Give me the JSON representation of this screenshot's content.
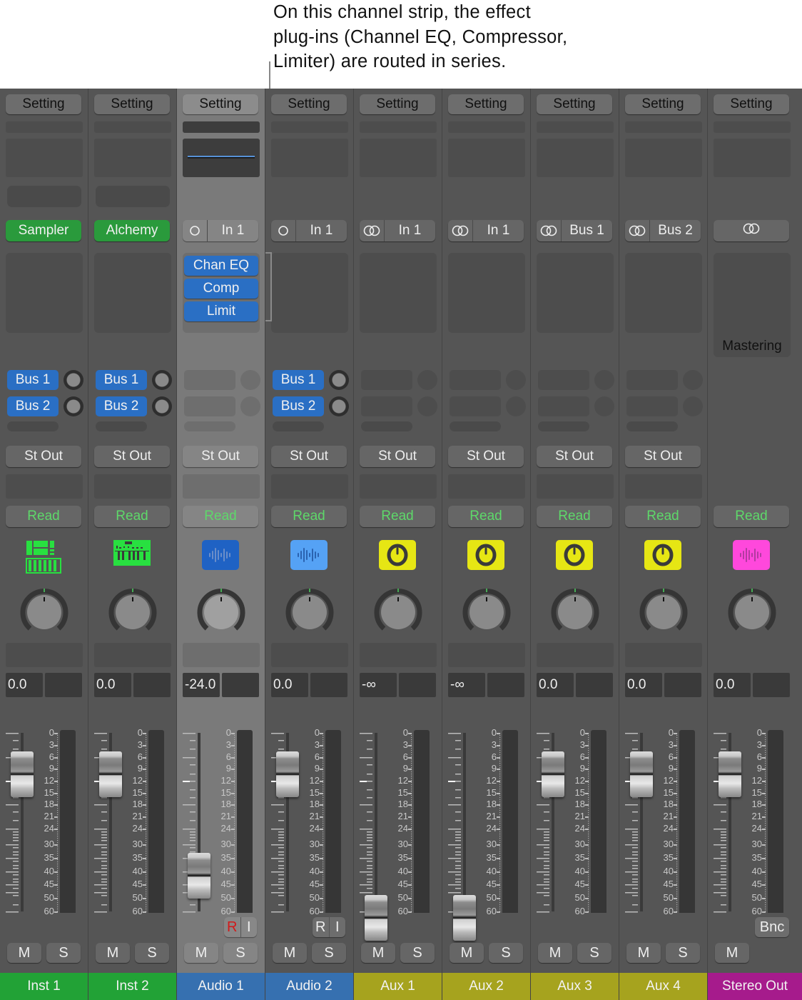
{
  "callout": {
    "line1": "On this channel strip, the effect",
    "line2": "plug-ins (Channel EQ, Compressor,",
    "line3": "Limiter) are routed in series."
  },
  "colors": {
    "inst": "#22a236",
    "audio": "#3670b0",
    "aux": "#a6a31e",
    "master": "#a61b8c",
    "plugin_blue": "#2a6fc4",
    "read_green": "#5ed86a"
  },
  "strips": [
    {
      "name": "Inst 1",
      "type": "inst",
      "setting": "Setting",
      "input": "Sampler",
      "input_icon": null,
      "inserts": [],
      "sends": [
        "Bus 1",
        "Bus 2"
      ],
      "output": "St Out",
      "automation": "Read",
      "track_icon": "drum-machine-icon",
      "volume": "0.0",
      "fader_db": -10.5,
      "ri": false,
      "solo": true
    },
    {
      "name": "Inst 2",
      "type": "inst",
      "setting": "Setting",
      "input": "Alchemy",
      "input_icon": null,
      "inserts": [],
      "sends": [
        "Bus 1",
        "Bus 2"
      ],
      "output": "St Out",
      "automation": "Read",
      "track_icon": "synth-keyboard-icon",
      "volume": "0.0",
      "fader_db": -10.5,
      "ri": false,
      "solo": true
    },
    {
      "name": "Audio 1",
      "type": "audio",
      "selected": true,
      "setting": "Setting",
      "input": "In 1",
      "input_icon": "mono",
      "inserts": [
        "Chan EQ",
        "Comp",
        "Limit"
      ],
      "sends": [],
      "output": "St Out",
      "automation": "Read",
      "track_icon": "waveform-icon",
      "volume": "-24.0",
      "fader_db": -42,
      "ri": true,
      "r_active": true,
      "solo": true
    },
    {
      "name": "Audio 2",
      "type": "audio",
      "setting": "Setting",
      "input": "In 1",
      "input_icon": "mono",
      "inserts": [],
      "sends": [
        "Bus 1",
        "Bus 2"
      ],
      "output": "St Out",
      "automation": "Read",
      "track_icon": "waveform-icon",
      "volume": "0.0",
      "fader_db": -10.5,
      "ri": true,
      "r_active": false,
      "solo": true
    },
    {
      "name": "Aux 1",
      "type": "aux",
      "setting": "Setting",
      "input": "In 1",
      "input_icon": "stereo",
      "inserts": [],
      "sends": [],
      "output": "St Out",
      "automation": "Read",
      "track_icon": "aux-knob-icon",
      "volume": "-∞",
      "fader_db": -70,
      "ri": false,
      "solo": true
    },
    {
      "name": "Aux 2",
      "type": "aux",
      "setting": "Setting",
      "input": "In 1",
      "input_icon": "stereo",
      "inserts": [],
      "sends": [],
      "output": "St Out",
      "automation": "Read",
      "track_icon": "aux-knob-icon",
      "volume": "-∞",
      "fader_db": -70,
      "ri": false,
      "solo": true
    },
    {
      "name": "Aux 3",
      "type": "aux",
      "setting": "Setting",
      "input": "Bus 1",
      "input_icon": "stereo",
      "inserts": [],
      "sends": [],
      "output": "St Out",
      "automation": "Read",
      "track_icon": "aux-knob-icon",
      "volume": "0.0",
      "fader_db": -10.5,
      "ri": false,
      "solo": true
    },
    {
      "name": "Aux 4",
      "type": "aux",
      "setting": "Setting",
      "input": "Bus 2",
      "input_icon": "stereo",
      "inserts": [],
      "sends": [],
      "output": "St Out",
      "automation": "Read",
      "track_icon": "aux-knob-icon",
      "volume": "0.0",
      "fader_db": -10.5,
      "ri": false,
      "solo": true
    },
    {
      "name": "Stereo Out",
      "type": "master",
      "setting": "Setting",
      "input": "",
      "input_icon": "stereo",
      "inserts": [],
      "mastering": "Mastering",
      "sends": [],
      "output": "",
      "automation": "Read",
      "track_icon": "waveform-pink-icon",
      "volume": "0.0",
      "fader_db": -10.5,
      "ri": false,
      "bnc": "Bnc",
      "solo": false
    }
  ],
  "labels": {
    "mute": "M",
    "solo": "S",
    "record": "R",
    "input_monitor": "I"
  },
  "meter_scale": [
    "0",
    "3",
    "6",
    "9",
    "12",
    "15",
    "18",
    "21",
    "24",
    "30",
    "35",
    "40",
    "45",
    "50",
    "60"
  ]
}
